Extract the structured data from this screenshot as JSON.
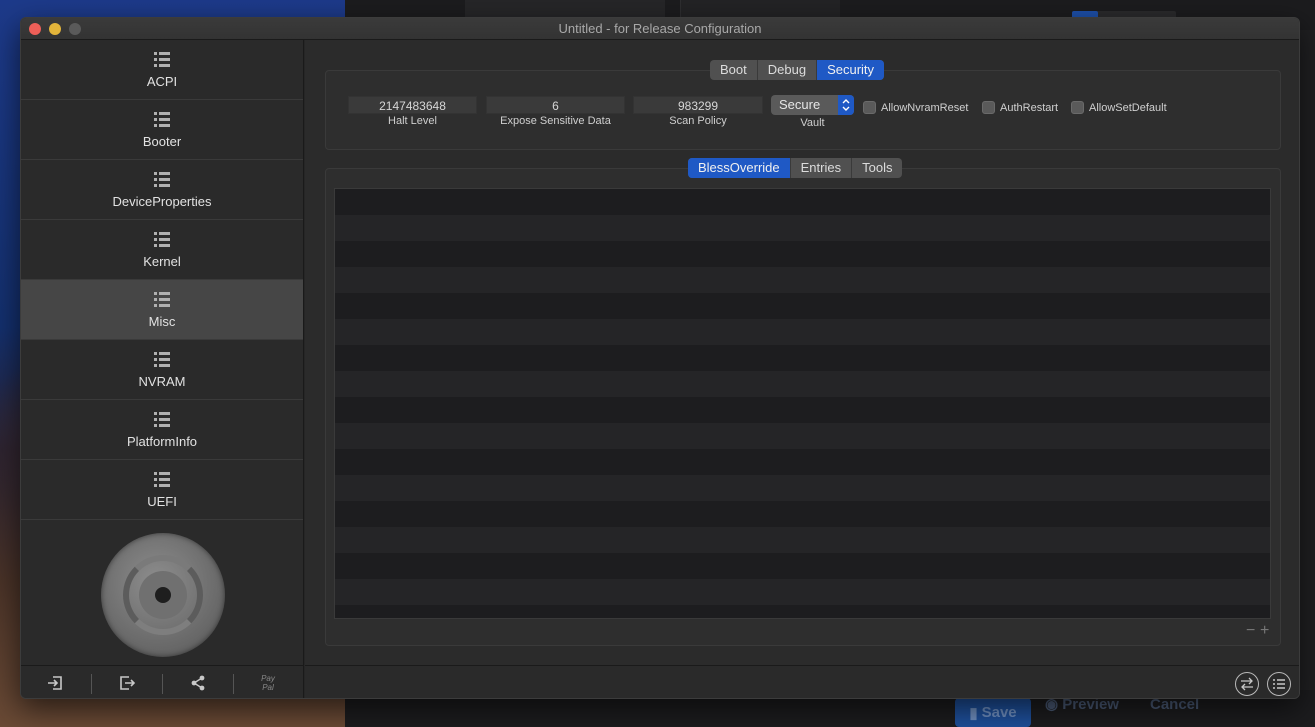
{
  "window": {
    "title": "Untitled - for Release Configuration"
  },
  "sidebar": {
    "items": [
      {
        "label": "ACPI"
      },
      {
        "label": "Booter"
      },
      {
        "label": "DeviceProperties"
      },
      {
        "label": "Kernel"
      },
      {
        "label": "Misc"
      },
      {
        "label": "NVRAM"
      },
      {
        "label": "PlatformInfo"
      },
      {
        "label": "UEFI"
      }
    ],
    "active": "Misc",
    "toolbar": {
      "paypal_line1": "Pay",
      "paypal_line2": "Pal"
    }
  },
  "top_tabs": {
    "boot": "Boot",
    "debug": "Debug",
    "security": "Security",
    "active": "Security"
  },
  "security": {
    "halt_level": {
      "value": "2147483648",
      "label": "Halt Level"
    },
    "expose_sensitive_data": {
      "value": "6",
      "label": "Expose Sensitive Data"
    },
    "scan_policy": {
      "value": "983299",
      "label": "Scan Policy"
    },
    "vault": {
      "value": "Secure",
      "label": "Vault"
    },
    "allow_nvram_reset": {
      "label": "AllowNvramReset",
      "checked": false
    },
    "auth_restart": {
      "label": "AuthRestart",
      "checked": false
    },
    "allow_set_default": {
      "label": "AllowSetDefault",
      "checked": false
    }
  },
  "bottom_tabs": {
    "bless_override": "BlessOverride",
    "entries": "Entries",
    "tools": "Tools",
    "active": "BlessOverride"
  },
  "background_window": {
    "save": "Save",
    "preview": "Preview",
    "cancel": "Cancel"
  },
  "colors": {
    "accent": "#1f59c5",
    "window_bg": "#2b2b2b",
    "sidebar_active": "#464646"
  }
}
